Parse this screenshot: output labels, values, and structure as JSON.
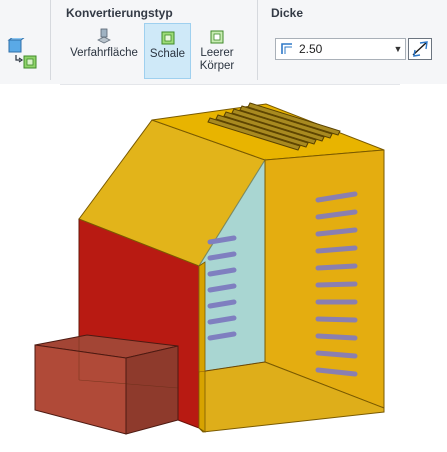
{
  "ribbon": {
    "conversion_group": {
      "title": "Konvertierungstyp",
      "buttons": [
        {
          "label": "Verfahrfläche",
          "icon": "quilt-surface-icon",
          "active": false
        },
        {
          "label": "Schale",
          "icon": "shell-icon",
          "active": true
        },
        {
          "label": "Leerer\nKörper",
          "icon": "empty-body-icon",
          "active": false
        }
      ]
    },
    "thickness_group": {
      "title": "Dicke",
      "value": "2.50",
      "dropdown_icon": "chevron-down-icon",
      "flip_icon": "flip-direction-icon"
    },
    "left_button_icon": "references-icon"
  },
  "model": {
    "colors": {
      "yellow": "#e8b400",
      "red": "#b81a12",
      "slot": "#8a7fb0",
      "glass": "#a9d6d2",
      "edge": "#7a5a00"
    }
  }
}
